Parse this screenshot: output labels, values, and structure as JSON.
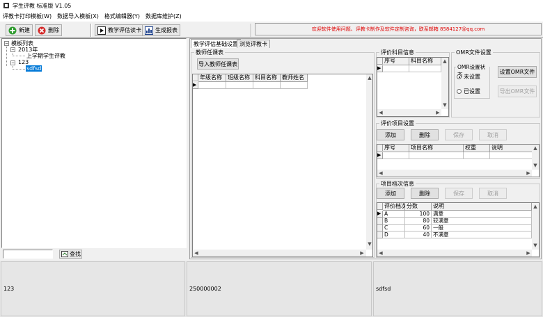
{
  "window": {
    "title": "学生评教 标准版 V1.05"
  },
  "menu": [
    "评教卡打印模板(W)",
    "数据导入模板(X)",
    "格式编辑器(Y)",
    "数据库维护(Z)"
  ],
  "toolbar": {
    "new_label": "新建",
    "delete_label": "删除",
    "read_card_label": "教学评估读卡",
    "report_label": "生成报表",
    "notice": "欢迎软件使用问题、评教卡制作及软件定制咨询，联系邮箱 8584127@qq.com"
  },
  "tree": {
    "root": "模板列表",
    "year": "2013年",
    "term": "上学期学生评教",
    "node123": "123",
    "selected": "sdfsd"
  },
  "search": {
    "button": "查找",
    "value": ""
  },
  "tabs": [
    "教学评估基础设置",
    "浏览评教卡"
  ],
  "teacher": {
    "group_title": "教师任课表",
    "import_button": "导入教师任课表",
    "columns": [
      "年级名称",
      "班级名称",
      "科目名称",
      "教师姓名"
    ]
  },
  "subject": {
    "group_title": "评价科目信息",
    "columns": [
      "序号",
      "科目名称"
    ]
  },
  "omr": {
    "group_title": "OMR文件设置",
    "status_title": "OMR设置状态",
    "not_set": "未设置",
    "set": "已设置",
    "set_button": "设置OMR文件",
    "export_button": "导出OMR文件"
  },
  "items": {
    "group_title": "评价项目设置",
    "add": "添加",
    "delete": "删除",
    "save": "保存",
    "cancel": "取消",
    "columns": [
      "序号",
      "项目名称",
      "权重",
      "说明"
    ]
  },
  "levels": {
    "group_title": "项目档次信息",
    "add": "添加",
    "delete": "删除",
    "save": "保存",
    "cancel": "取消",
    "columns": [
      "评价档次",
      "分数",
      "说明"
    ],
    "rows": [
      {
        "level": "A",
        "score": "100",
        "desc": "满意"
      },
      {
        "level": "B",
        "score": "80",
        "desc": "较满意"
      },
      {
        "level": "C",
        "score": "60",
        "desc": "一般"
      },
      {
        "level": "D",
        "score": "40",
        "desc": "不满意"
      }
    ]
  },
  "statusbar": [
    "123",
    "250000002",
    "sdfsd"
  ]
}
